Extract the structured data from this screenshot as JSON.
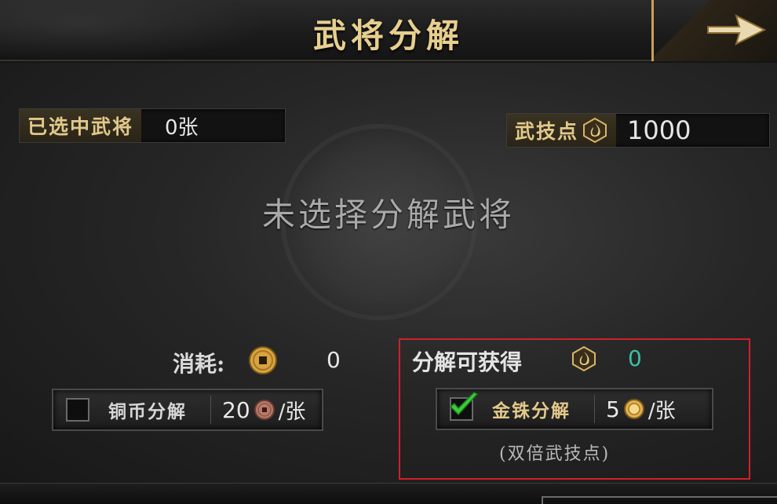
{
  "header": {
    "title": "武将分解"
  },
  "selected": {
    "label": "已选中武将",
    "value": "0张"
  },
  "skill_points": {
    "label": "武技点",
    "value": "1000"
  },
  "empty_hint": "未选择分解武将",
  "cost": {
    "label": "消耗:",
    "value": "0"
  },
  "gain": {
    "label": "分解可获得",
    "value": "0"
  },
  "copper_option": {
    "label": "铜币分解",
    "price": "20",
    "unit": "/张",
    "checked": false
  },
  "gold_option": {
    "label": "金铢分解",
    "price": "5",
    "unit": "/张",
    "checked": true
  },
  "double_note": "(双倍武技点)",
  "colors": {
    "gold_text": "#e2c98a",
    "teal_value": "#3bbfa6",
    "highlight_border": "#d0202a",
    "check_green": "#38c43a"
  }
}
